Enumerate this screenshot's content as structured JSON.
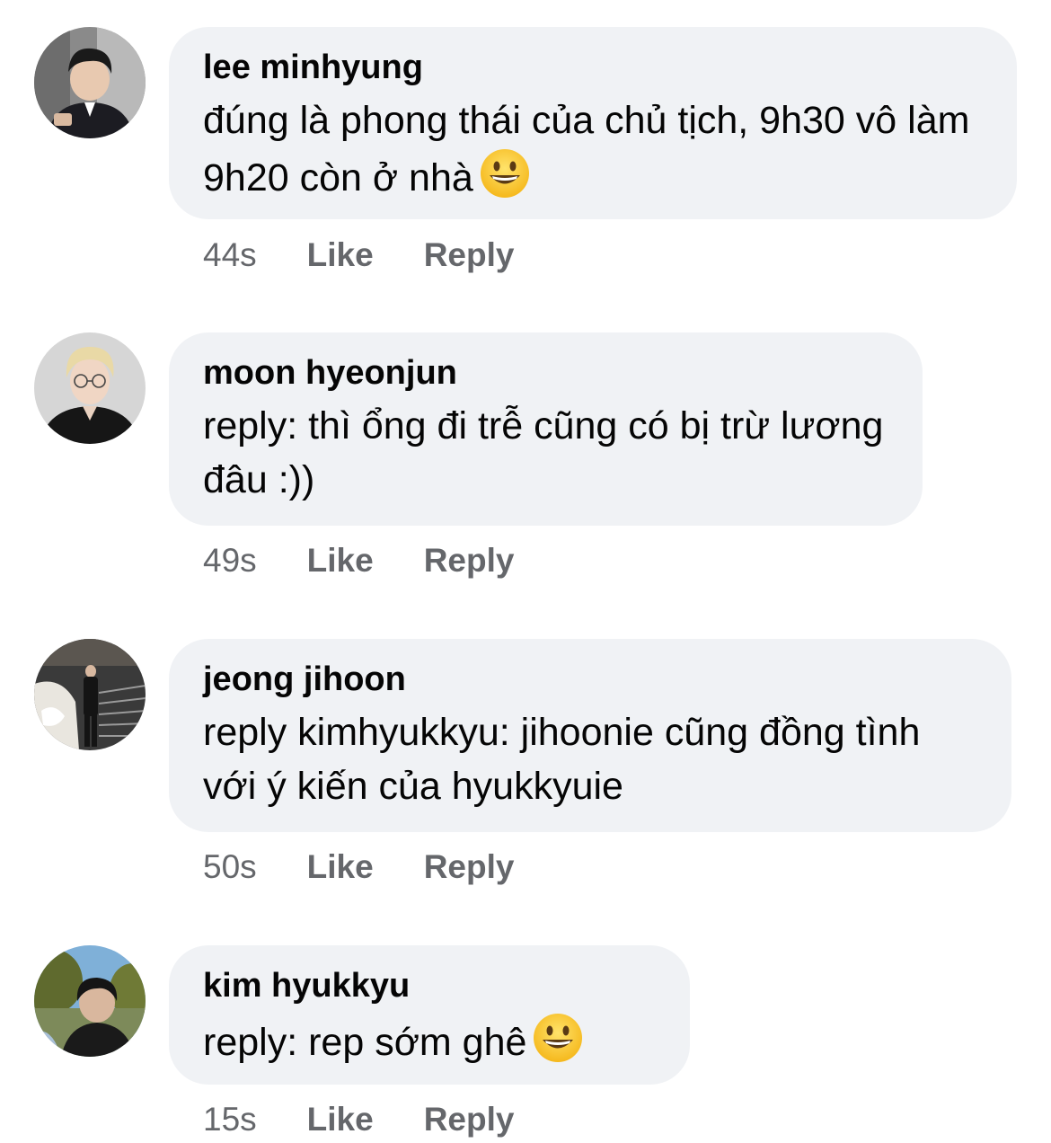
{
  "comments": [
    {
      "author": "lee minhyung",
      "text": "đúng là phong thái của chủ tịch, 9h30 vô làm 9h20 còn ở nhà",
      "emoji": "grinning-face-emoji",
      "time": "44s",
      "like_label": "Like",
      "reply_label": "Reply"
    },
    {
      "author": "moon hyeonjun",
      "text": "reply: thì ổng đi trễ cũng có bị trừ lương đâu :))",
      "time": "49s",
      "like_label": "Like",
      "reply_label": "Reply"
    },
    {
      "author": "jeong jihoon",
      "text": "reply kimhyukkyu: jihoonie cũng đồng tình với ý kiến của hyukkyuie",
      "time": "50s",
      "like_label": "Like",
      "reply_label": "Reply"
    },
    {
      "author": "kim hyukkyu",
      "text": "reply: rep sớm ghê",
      "emoji": "grinning-face-emoji",
      "time": "15s",
      "like_label": "Like",
      "reply_label": "Reply"
    }
  ],
  "colors": {
    "bubble_bg": "#f0f2f5",
    "secondary_text": "#65676b",
    "primary_text": "#050505"
  }
}
